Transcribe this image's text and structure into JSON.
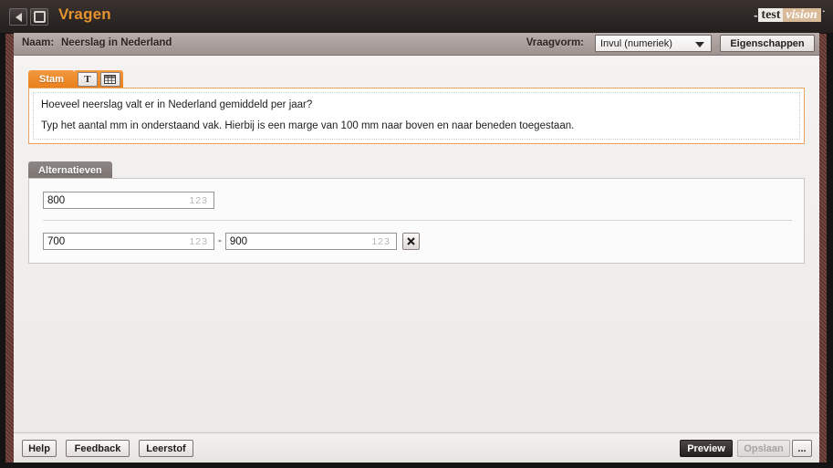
{
  "titlebar": {
    "title": "Vragen",
    "back_icon": "triangle-left-icon",
    "stop_icon": "square-stop-icon",
    "logo": {
      "lead_dash": "-",
      "part1": "test",
      "part2": "vision",
      "trail_dot": "˙"
    }
  },
  "namebar": {
    "name_label": "Naam:",
    "name_value": "Neerslag in Nederland",
    "vraagvorm_label": "Vraagvorm:",
    "vraagvorm_value": "Invul (numeriek)",
    "properties_button": "Eigenschappen"
  },
  "stam": {
    "tab_label": "Stam",
    "text_tool_glyph": "T",
    "table_tool_name": "table-icon",
    "line1": "Hoeveel neerslag valt er in Nederland gemiddeld per jaar?",
    "line2": "Typ het aantal mm in onderstaand vak. Hierbij is een marge van 100 mm naar boven en naar beneden toegestaan."
  },
  "alternatieven": {
    "tab_label": "Alternatieven",
    "rows": [
      {
        "type": "single",
        "value": "800",
        "hint": "123"
      },
      {
        "type": "range",
        "from_value": "700",
        "from_hint": "123",
        "separator": "-",
        "to_value": "900",
        "to_hint": "123",
        "delete_label": "✖"
      }
    ]
  },
  "bottombar": {
    "help": "Help",
    "feedback": "Feedback",
    "leerstof": "Leerstof",
    "preview": "Preview",
    "opslaan": "Opslaan",
    "more": "..."
  },
  "colors": {
    "accent_orange": "#ea7f1b",
    "title_text": "#e5922f",
    "frame_maroon": "#6e3b34",
    "titlebar_dark": "#2e2826",
    "namebar_taupe": "#ab9f9d",
    "panel_bg": "#f1efed",
    "alt_tab_gray": "#7a7370"
  }
}
